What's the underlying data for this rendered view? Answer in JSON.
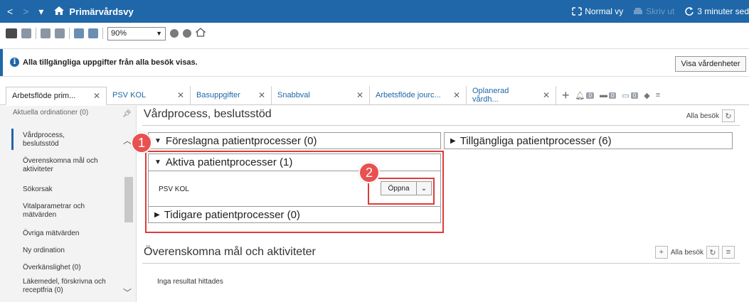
{
  "titlebar": {
    "back": "<",
    "forward": ">",
    "dropdown": "▾",
    "title": "Primärvårdsvy",
    "view_mode": "Normal vy",
    "print": "Skriv ut",
    "refresh": "3 minuter sed"
  },
  "toolbar": {
    "zoom": "90%"
  },
  "info": {
    "icon_text": "i",
    "message": "Alla tillgängliga uppgifter från alla besök visas.",
    "button": "Visa vårdenheter"
  },
  "tabs": [
    {
      "label": "Arbetsflöde prim..."
    },
    {
      "label": "PSV KOL"
    },
    {
      "label": "Basuppgifter"
    },
    {
      "label": "Snabbval"
    },
    {
      "label": "Arbetsflöde jourc..."
    },
    {
      "label": "Oplanerad vårdh..."
    }
  ],
  "tab_tools": {
    "plus": "+",
    "badge1": "0",
    "badge2": "0",
    "badge3": "0",
    "badge4": "0"
  },
  "sidebar": {
    "items": [
      "Aktuella ordinationer (0)",
      "Vårdprocess, beslutsstöd",
      "Överenskomna mål och aktiviteter",
      "Sökorsak",
      "Vitalparametrar och mätvärden",
      "Övriga mätvärden",
      "Ny ordination",
      "Överkänslighet (0)",
      "Läkemedel, förskrivna och receptfria (0)"
    ]
  },
  "main": {
    "section1_title": "Vårdprocess, beslutsstöd",
    "alla_besok": "Alla besök",
    "foreslagna": "Föreslagna patientprocesser (0)",
    "tillgangliga": "Tillgängliga patientprocesser (6)",
    "aktiva": "Aktiva patientprocesser (1)",
    "process_item": "PSV KOL",
    "open_button": "Öppna",
    "tidigare": "Tidigare patientprocesser (0)",
    "section2_title": "Överenskomna mål och aktiviteter",
    "no_result": "Inga resultat hittades"
  },
  "markers": {
    "m1": "1",
    "m2": "2"
  },
  "colors": {
    "titlebar": "#1f67a8",
    "highlight": "#e03a3a",
    "marker": "#e85151"
  }
}
